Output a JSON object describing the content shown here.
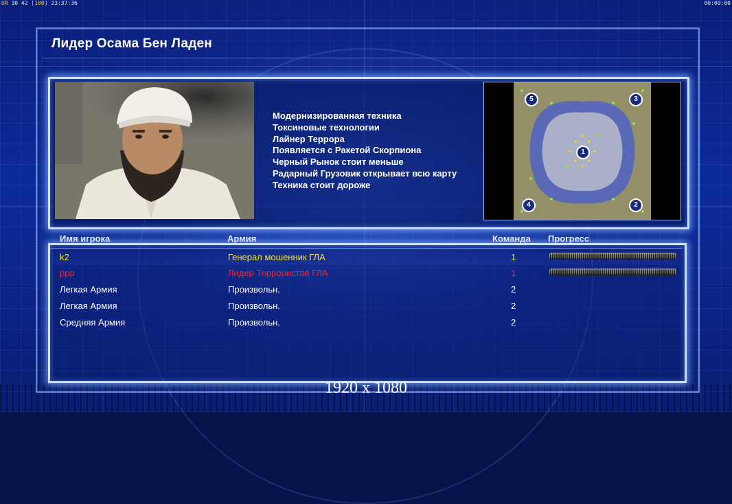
{
  "topbar": {
    "fps_label": "UR",
    "fps_values": "30 42",
    "fps_extra": "[100]",
    "clock": "23:37:36",
    "game_timer": "00:00:00"
  },
  "header": {
    "title": "Лидер Осама Бен Ладен"
  },
  "general": {
    "features": [
      "Модернизированная техника",
      "Токсиновые технологии",
      "Лайнер Террора",
      "Появляется с Ракетой Скорпиона",
      "Черный Рынок стоит меньше",
      "Радарный Грузовик открывает всю карту",
      "Техника стоит дороже"
    ]
  },
  "minimap": {
    "start_positions": [
      "5",
      "3",
      "1",
      "4",
      "2"
    ]
  },
  "table": {
    "headers": {
      "name": "Имя игрока",
      "army": "Армия",
      "team": "Команда",
      "progress": "Прогресс"
    },
    "rows": [
      {
        "name": "k2",
        "army": "Генерал мошенник ГЛА",
        "team": "1",
        "color": "#f2e23a",
        "progress": 1.0
      },
      {
        "name": "ppp",
        "army": "Лидер Террористов ГЛА",
        "team": "1",
        "color": "#ff2020",
        "progress": 1.0
      },
      {
        "name": "Легкая Армия",
        "army": "Произвольн.",
        "team": "2",
        "color": "#ffffff"
      },
      {
        "name": "Легкая Армия",
        "army": "Произвольн.",
        "team": "2",
        "color": "#ffffff"
      },
      {
        "name": "Средняя Армия",
        "army": "Произвольн.",
        "team": "2",
        "color": "#ffffff"
      }
    ]
  },
  "footer": {
    "resolution": "1920 x 1080"
  },
  "colors": {
    "panel_border": "#cfe0ff",
    "background": "#0b2a9a"
  }
}
